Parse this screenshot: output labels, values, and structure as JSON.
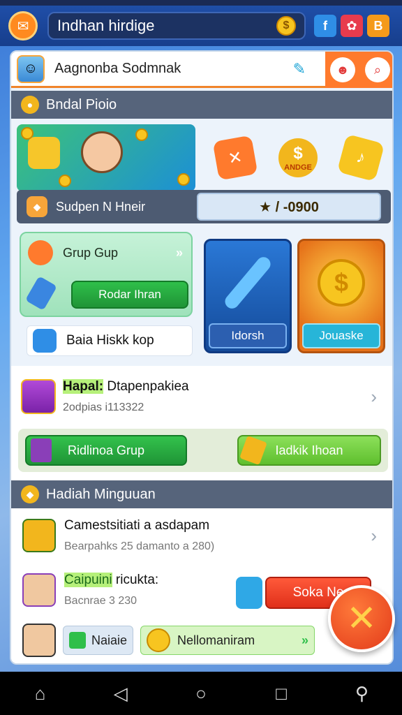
{
  "header": {
    "mail_icon": "mail-icon",
    "title": "Indhan hirdige",
    "coin_symbol": "$",
    "social": [
      {
        "icon": "facebook-icon",
        "glyph": "f"
      },
      {
        "icon": "app-icon-red",
        "glyph": "✿"
      },
      {
        "icon": "app-icon-orange",
        "glyph": "B"
      }
    ]
  },
  "user": {
    "name": "Aagnonba Sodmnak",
    "edit_icon": "edit-icon"
  },
  "section1": {
    "title": "Bndal Pioio"
  },
  "rewards": {
    "badge_text": "ANDGE"
  },
  "super": {
    "label": "Sudpen N Hneir",
    "value": "★ / -0900"
  },
  "grup": {
    "label": "Grup Gup",
    "arrow": "»",
    "button": "Rodar Ihran"
  },
  "baia": {
    "label": "Baia Hiskk kop"
  },
  "tiles": [
    {
      "label": "Idorsh"
    },
    {
      "label": "Jouaske"
    }
  ],
  "haql": {
    "highlight": "Hapal:",
    "title_rest": " Dtapenpakiea",
    "subtitle": "2odpias i113322"
  },
  "buttons": {
    "left": "Ridlinoa Grup",
    "right": "Iadkik Ihoan"
  },
  "section2": {
    "title": "Hadiah Minguuan"
  },
  "items": [
    {
      "title": "Camestsitiati a asdapam",
      "subtitle": "Bearpahks 25 damanto a 280)"
    },
    {
      "highlight": "Caipuini",
      "title_rest": " ricukta:",
      "subtitle": "Bacnrae 3 230",
      "button": "Soka Ne"
    }
  ],
  "bottom": {
    "chip1": "Naiaie",
    "chip2": "Nellomaniram",
    "go": "»"
  },
  "navbar": {
    "home": "⌂",
    "back": "◁",
    "circle": "○",
    "square": "□",
    "extra": "⚲"
  }
}
